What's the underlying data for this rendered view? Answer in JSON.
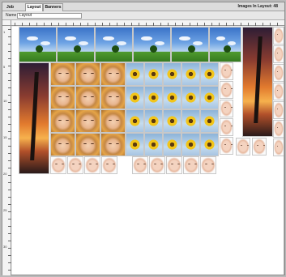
{
  "tabs": [
    {
      "label": "Job"
    },
    {
      "label": "Layout"
    },
    {
      "label": "Banners"
    }
  ],
  "layout": {
    "name_label": "Name",
    "name_value": "Layout",
    "images_count": "Images In Layout: 48"
  },
  "ruler": {
    "left_labels": [
      "1",
      "5",
      "10",
      "15",
      "20",
      "25",
      "30"
    ]
  },
  "images": {
    "landscape": "sky-landscape",
    "tower": "sunset-tower",
    "face": "face-portrait",
    "flower": "sunflower",
    "baby": "baby-portrait"
  }
}
